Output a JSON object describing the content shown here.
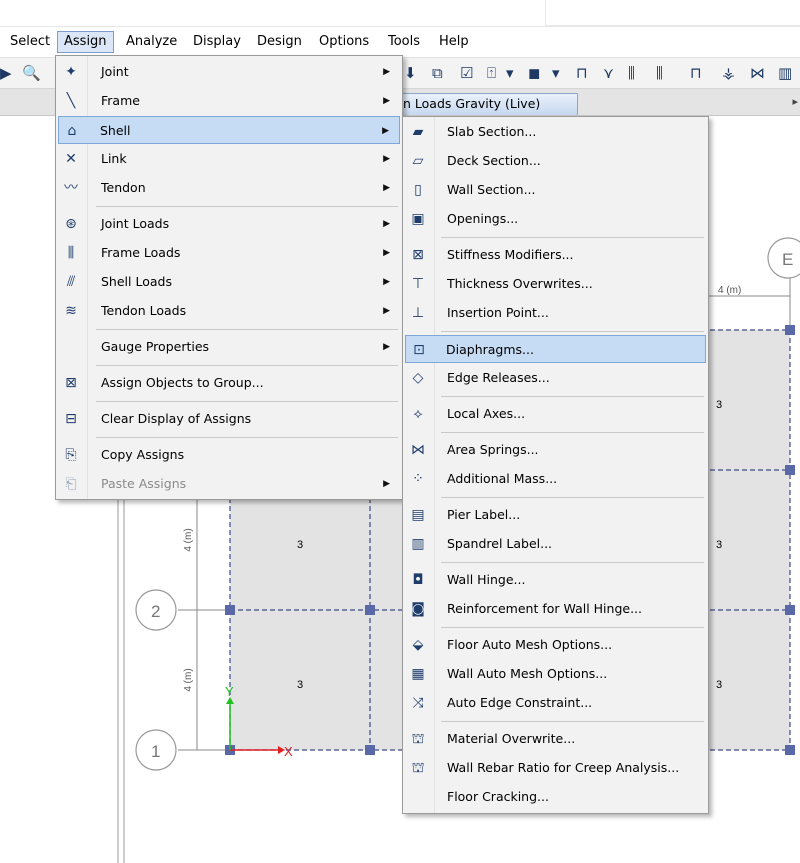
{
  "menubar": {
    "items": [
      "Select",
      "Assign",
      "Analyze",
      "Display",
      "Design",
      "Options",
      "Tools",
      "Help"
    ]
  },
  "tab": {
    "label": "n Loads Gravity  (Live)"
  },
  "assign_menu": {
    "items": [
      {
        "label": "Joint",
        "icon": "joint-icon",
        "submenu": true
      },
      {
        "label": "Frame",
        "icon": "frame-icon",
        "submenu": true
      },
      {
        "label": "Shell",
        "icon": "shell-icon",
        "submenu": true,
        "highlighted": true
      },
      {
        "label": "Link",
        "icon": "link-icon",
        "submenu": true
      },
      {
        "label": "Tendon",
        "icon": "tendon-icon",
        "submenu": true
      },
      {
        "label": "Joint Loads",
        "icon": "joint-loads-icon",
        "submenu": true
      },
      {
        "label": "Frame Loads",
        "icon": "frame-loads-icon",
        "submenu": true
      },
      {
        "label": "Shell Loads",
        "icon": "shell-loads-icon",
        "submenu": true
      },
      {
        "label": "Tendon Loads",
        "icon": "tendon-loads-icon",
        "submenu": true
      },
      {
        "label": "Gauge Properties",
        "icon": "",
        "submenu": true
      },
      {
        "label": "Assign Objects to Group...",
        "icon": "group-icon",
        "submenu": false
      },
      {
        "label": "Clear Display of Assigns",
        "icon": "clear-display-icon",
        "submenu": false
      },
      {
        "label": "Copy Assigns",
        "icon": "copy-icon",
        "submenu": false
      },
      {
        "label": "Paste Assigns",
        "icon": "paste-icon",
        "submenu": true,
        "disabled": true
      }
    ]
  },
  "shell_menu": {
    "items": [
      {
        "label": "Slab Section...",
        "icon": "slab-section-icon"
      },
      {
        "label": "Deck Section...",
        "icon": "deck-section-icon"
      },
      {
        "label": "Wall Section...",
        "icon": "wall-section-icon"
      },
      {
        "label": "Openings...",
        "icon": "openings-icon"
      },
      {
        "label": "Stiffness Modifiers...",
        "icon": "stiffness-modifiers-icon"
      },
      {
        "label": "Thickness Overwrites...",
        "icon": "thickness-overwrites-icon"
      },
      {
        "label": "Insertion Point...",
        "icon": "insertion-point-icon"
      },
      {
        "label": "Diaphragms...",
        "icon": "diaphragms-icon",
        "highlighted": true
      },
      {
        "label": "Edge Releases...",
        "icon": "edge-releases-icon"
      },
      {
        "label": "Local Axes...",
        "icon": "local-axes-icon"
      },
      {
        "label": "Area Springs...",
        "icon": "area-springs-icon"
      },
      {
        "label": "Additional Mass...",
        "icon": "additional-mass-icon"
      },
      {
        "label": "Pier Label...",
        "icon": "pier-label-icon"
      },
      {
        "label": "Spandrel Label...",
        "icon": "spandrel-label-icon"
      },
      {
        "label": "Wall Hinge...",
        "icon": "wall-hinge-icon"
      },
      {
        "label": "Reinforcement for Wall Hinge...",
        "icon": "reinforcement-hinge-icon"
      },
      {
        "label": "Floor Auto Mesh Options...",
        "icon": "floor-mesh-icon"
      },
      {
        "label": "Wall Auto Mesh Options...",
        "icon": "wall-mesh-icon"
      },
      {
        "label": "Auto Edge Constraint...",
        "icon": "edge-constraint-icon"
      },
      {
        "label": "Material Overwrite...",
        "icon": "material-overwrite-icon"
      },
      {
        "label": "Wall Rebar Ratio for Creep Analysis...",
        "icon": "rebar-ratio-icon"
      },
      {
        "label": "Floor Cracking...",
        "icon": ""
      }
    ]
  },
  "canvas": {
    "grid_bubbles": [
      "E",
      "2",
      "1"
    ],
    "dimension_top": "4 (m)",
    "dimension_left_1": "4 (m)",
    "dimension_left_2": "4 (m)",
    "area_labels": [
      "3",
      "3",
      "3",
      "3",
      "3"
    ],
    "axis_x": "X",
    "axis_y": "Y"
  },
  "colors": {
    "menu_highlight": "#c6dcf5",
    "panel_fill": "#e2e2e2",
    "grid_line": "#3c4a8c",
    "joint": "#5a68a8",
    "axis_x": "#e02020",
    "axis_y": "#20c020"
  }
}
